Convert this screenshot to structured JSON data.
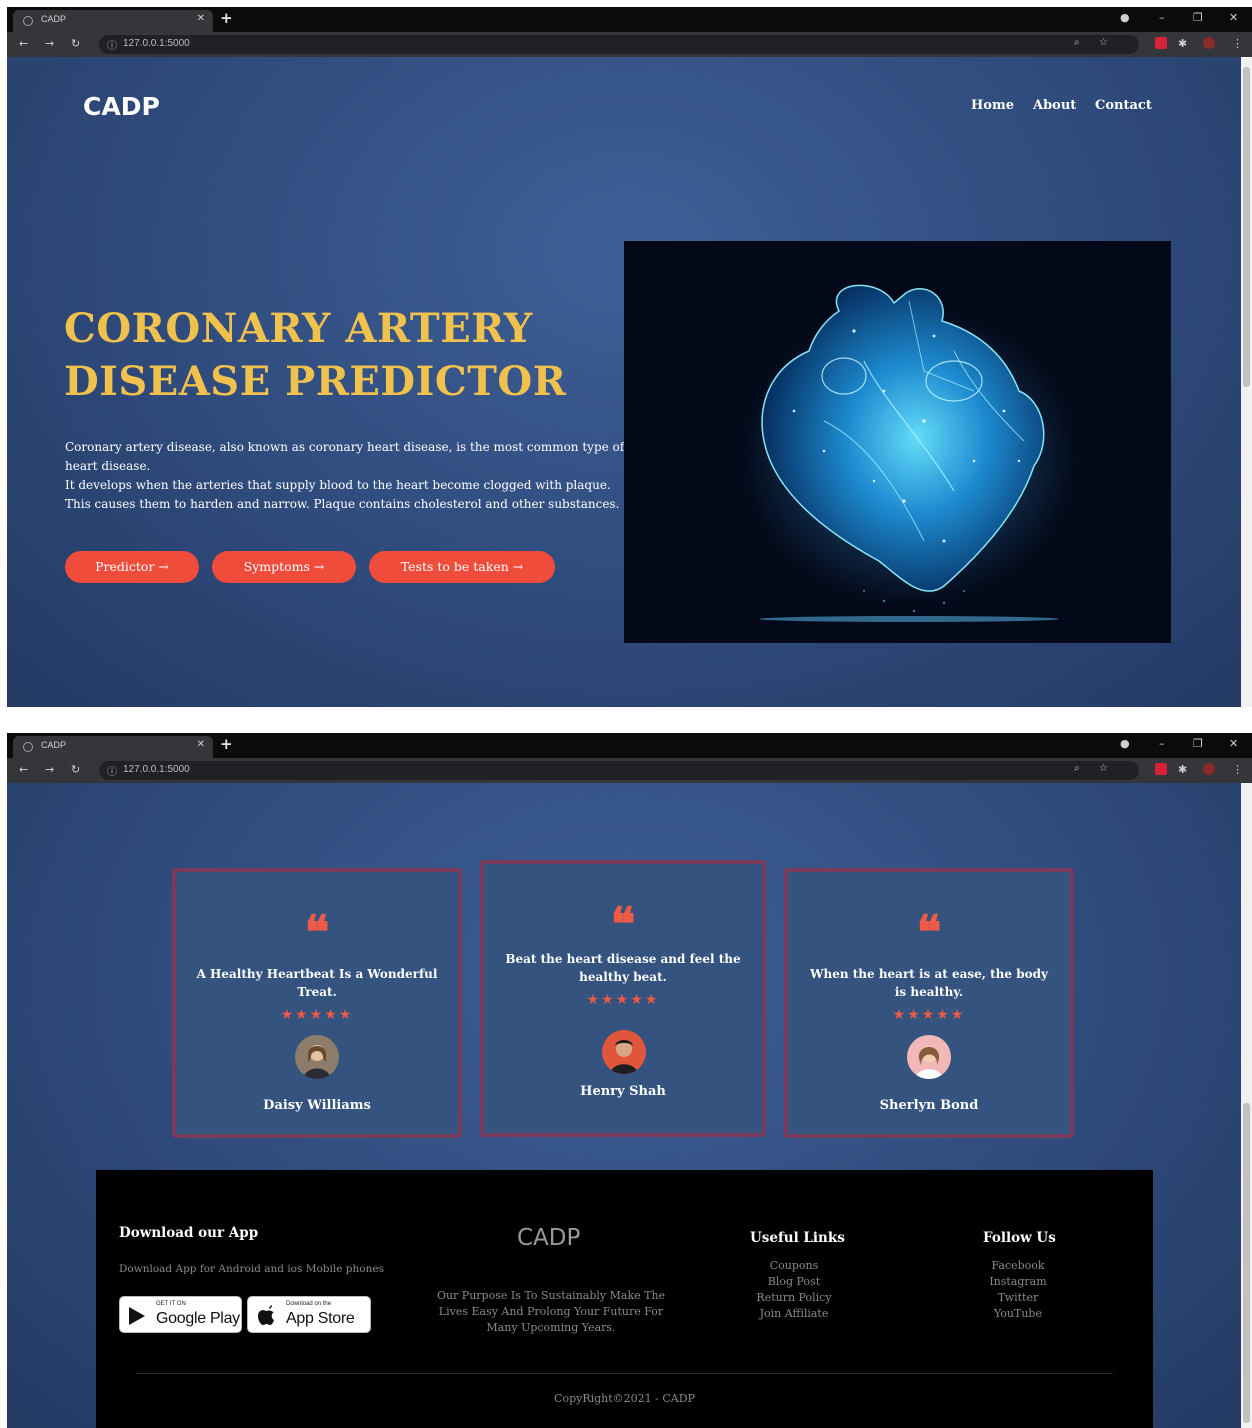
{
  "browser": {
    "tab_title": "CADP",
    "url": "127.0.0.1:5000"
  },
  "nav": {
    "brand": "CADP",
    "links": [
      "Home",
      "About",
      "Contact"
    ]
  },
  "hero": {
    "title_line1": "CORONARY ARTERY",
    "title_line2": "DISEASE PREDICTOR",
    "desc_line1": "Coronary artery disease, also known as coronary heart disease, is the most common type of heart disease.",
    "desc_line2": "It develops when the arteries that supply blood to the heart become clogged with plaque. This causes them to harden and narrow. Plaque contains cholesterol and other substances.",
    "buttons": [
      "Predictor →",
      "Symptoms →",
      "Tests to be taken →"
    ]
  },
  "testimonials": [
    {
      "quote": "A Healthy Heartbeat Is a Wonderful Treat.",
      "stars": "★★★★★",
      "name": "Daisy Williams"
    },
    {
      "quote": "Beat the heart disease and feel the healthy beat.",
      "stars": "★★★★★",
      "name": "Henry Shah"
    },
    {
      "quote": "When the heart is at ease, the body is healthy.",
      "stars": "★★★★★",
      "name": "Sherlyn Bond"
    }
  ],
  "footer": {
    "download_heading": "Download our App",
    "download_sub": "Download App for Android and ios Mobile phones",
    "google_small": "GET IT ON",
    "google_big": "Google Play",
    "apple_small": "Download on the",
    "apple_big": "App Store",
    "logo": "CADP",
    "purpose": "Our Purpose Is To Sustainably Make The Lives Easy And Prolong Your Future For Many Upcoming Years.",
    "useful_heading": "Useful Links",
    "useful_links": [
      "Coupons",
      "Blog Post",
      "Return Policy",
      "Join Affiliate"
    ],
    "follow_heading": "Follow Us",
    "follow_links": [
      "Facebook",
      "Instagram",
      "Twitter",
      "YouTube"
    ],
    "copyright": "CopyRight©2021 - CADP"
  },
  "colors": {
    "accent": "#f04c3b",
    "title_gold": "#f0c24d",
    "page_blue": "#2f4b7c",
    "card_border": "#7a3a5c"
  }
}
